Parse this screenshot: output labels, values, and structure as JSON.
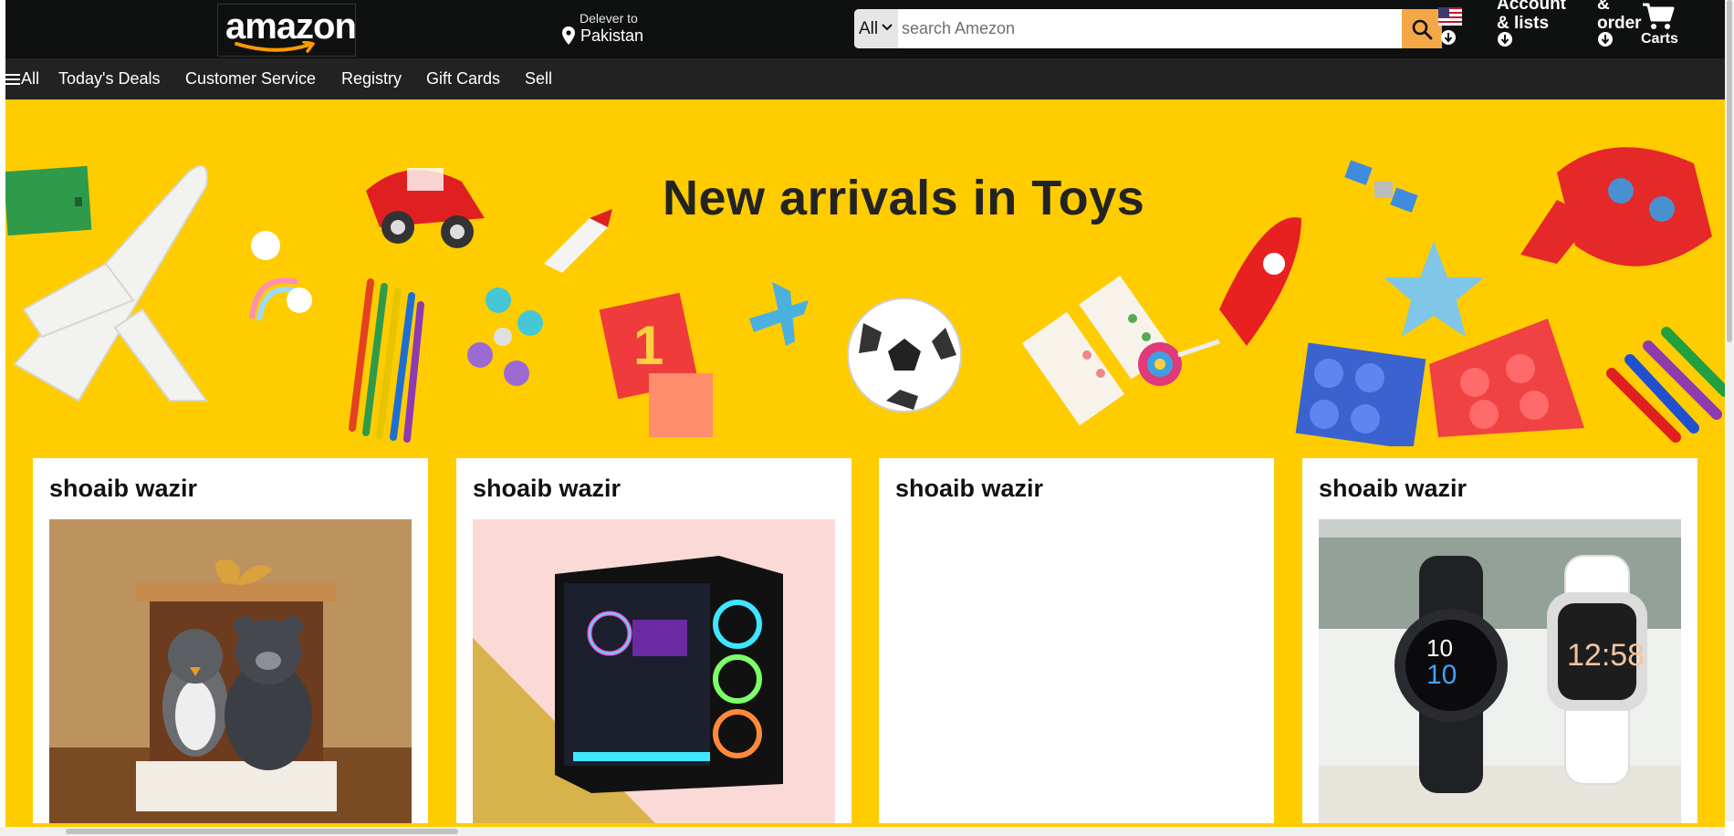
{
  "header": {
    "logo_text": "amazon",
    "deliver_label": "Delever to",
    "deliver_location": "Pakistan",
    "search": {
      "category": "All",
      "placeholder": "search Amezon"
    },
    "account_line1": "Account",
    "account_line2": "& lists",
    "orders_line1": "&",
    "orders_line2": "order",
    "cart_label": "Carts"
  },
  "nav": {
    "items": [
      {
        "label": "All"
      },
      {
        "label": "Today's Deals"
      },
      {
        "label": "Customer Service"
      },
      {
        "label": "Registry"
      },
      {
        "label": "Gift Cards"
      },
      {
        "label": "Sell"
      }
    ]
  },
  "hero": {
    "title": "New arrivals in Toys"
  },
  "cards": [
    {
      "title": "shoaib wazir",
      "image": "plush-toys-gift-box"
    },
    {
      "title": "shoaib wazir",
      "image": "gaming-pc-case"
    },
    {
      "title": "shoaib wazir",
      "image": "empty"
    },
    {
      "title": "shoaib wazir",
      "image": "smartwatches"
    }
  ],
  "icons": {
    "location": "map-pin-icon",
    "search": "magnifier-icon",
    "cart": "shopping-cart-icon",
    "menu": "hamburger-icon",
    "flag": "us-flag-icon"
  },
  "colors": {
    "header_bg": "#0f1111",
    "nav_bg": "#222222",
    "hero_bg": "#ffcc00",
    "search_button": "#f3a847",
    "logo_smile": "#ff9900"
  }
}
